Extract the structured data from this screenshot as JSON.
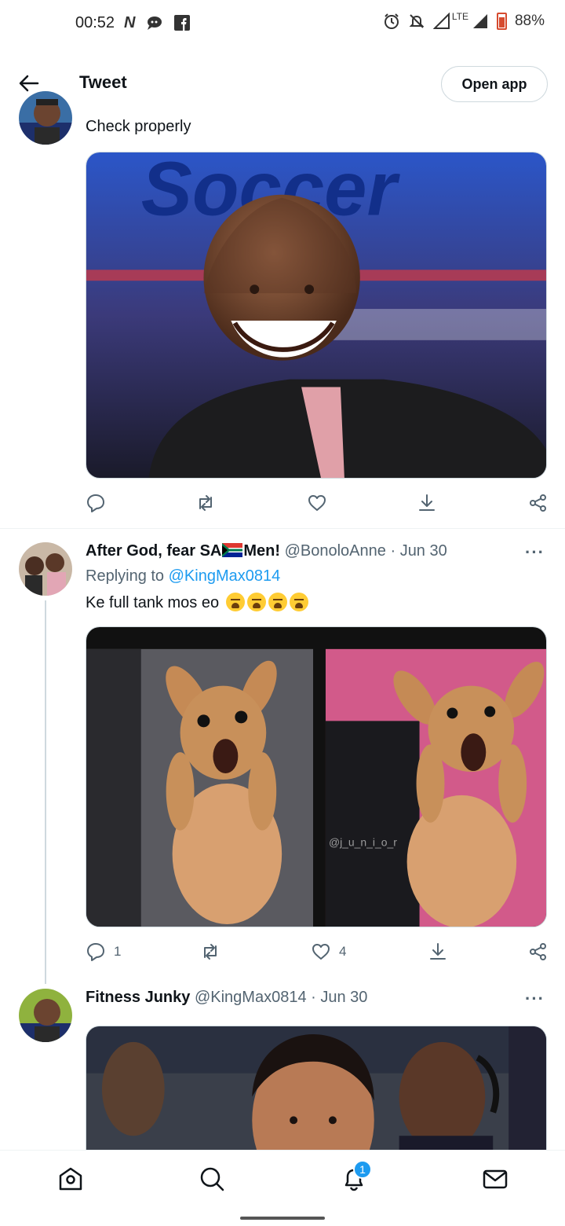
{
  "status_bar": {
    "time": "00:52",
    "left_icons": [
      "n-icon",
      "chat-icon",
      "facebook-icon"
    ],
    "right_icons": [
      "alarm-icon",
      "mute-icon",
      "signal-icon",
      "signal-icon"
    ],
    "network": "LTE",
    "battery": "88%"
  },
  "header": {
    "title": "Tweet",
    "open_app_label": "Open app"
  },
  "tweets": [
    {
      "text": "Check properly",
      "image_text": "Soccer",
      "actions": {
        "reply_count": "",
        "retweet_count": "",
        "like_count": ""
      }
    },
    {
      "display_name": "After God, fear SA",
      "display_name_suffix": "Men!",
      "handle": "@BonoloAnne",
      "dot": "·",
      "date": "Jun 30",
      "replying_prefix": "Replying to",
      "replying_to": "@KingMax0814",
      "text": "Ke full tank mos eo",
      "image_watermark": "@j_u_n_i_o_r",
      "actions": {
        "reply_count": "1",
        "retweet_count": "",
        "like_count": "4"
      }
    },
    {
      "display_name": "Fitness Junky",
      "handle": "@KingMax0814",
      "dot": "·",
      "date": "Jun 30"
    }
  ],
  "more_label": "···",
  "bottom_nav": {
    "items": [
      "home-icon",
      "search-icon",
      "notifications-icon",
      "messages-icon"
    ],
    "notification_badge": "1"
  },
  "colors": {
    "accent": "#1d9bf0",
    "text_primary": "#0f1419",
    "text_secondary": "#536471",
    "border": "#cfd9de"
  }
}
